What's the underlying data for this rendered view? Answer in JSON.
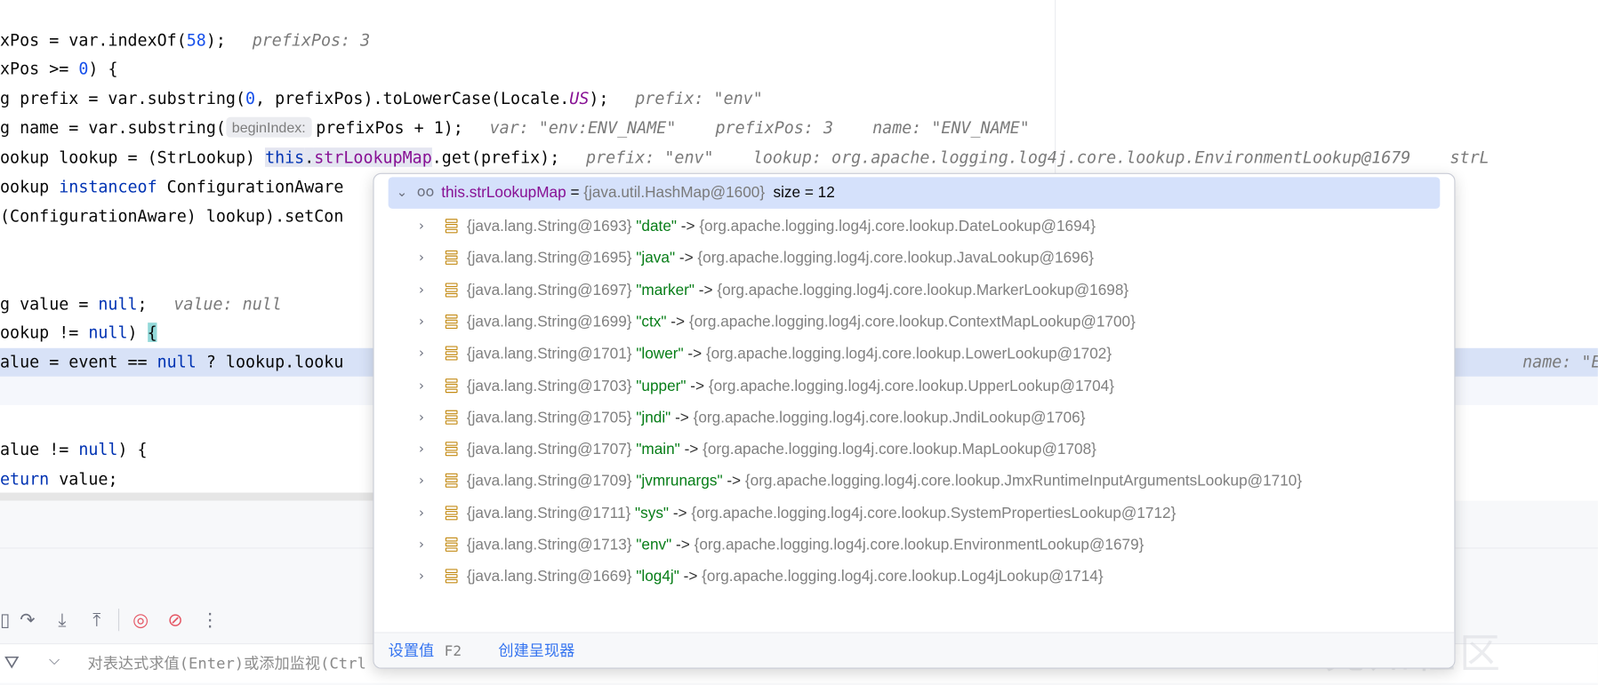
{
  "editor": {
    "lines": [
      {
        "text": "xPos = var.indexOf(58);",
        "inline": "prefixPos: 3"
      },
      {
        "text": "xPos >= 0) {"
      },
      {
        "text": "g prefix = var.substring(0, prefixPos).toLowerCase(Locale.US);",
        "inline": "prefix: \"env\""
      },
      {
        "pre": "g name = var.substring(",
        "hint": "beginIndex:",
        "post": "prefixPos + 1);",
        "inline": "var: \"env:ENV_NAME\"    prefixPos: 3    name: \"ENV_NAME\""
      },
      {
        "text": "ookup lookup = (StrLookup) this.strLookupMap.get(prefix);",
        "inline": "prefix: \"env\"    lookup: org.apache.logging.log4j.core.lookup.EnvironmentLookup@1679    strL"
      },
      {
        "text": "ookup instanceof ConfigurationAware"
      },
      {
        "text": "(ConfigurationAware) lookup).setCon"
      },
      {
        "text": "g value = null;",
        "inline": "value: null"
      },
      {
        "text": "ookup != null) {"
      },
      {
        "text": "alue = event == null ? lookup.looku",
        "inline": "name: \"ENV"
      },
      {
        "text": "alue != null) {"
      },
      {
        "text": "eturn value;"
      }
    ]
  },
  "popup": {
    "root": {
      "name": "this.strLookupMap",
      "eq": "=",
      "type": "{java.util.HashMap@1600}",
      "size": "size = 12"
    },
    "entries": [
      {
        "ref": "{java.lang.String@1693}",
        "key": "\"date\"",
        "arrow": "->",
        "val": "{org.apache.logging.log4j.core.lookup.DateLookup@1694}"
      },
      {
        "ref": "{java.lang.String@1695}",
        "key": "\"java\"",
        "arrow": "->",
        "val": "{org.apache.logging.log4j.core.lookup.JavaLookup@1696}"
      },
      {
        "ref": "{java.lang.String@1697}",
        "key": "\"marker\"",
        "arrow": "->",
        "val": "{org.apache.logging.log4j.core.lookup.MarkerLookup@1698}"
      },
      {
        "ref": "{java.lang.String@1699}",
        "key": "\"ctx\"",
        "arrow": "->",
        "val": "{org.apache.logging.log4j.core.lookup.ContextMapLookup@1700}"
      },
      {
        "ref": "{java.lang.String@1701}",
        "key": "\"lower\"",
        "arrow": "->",
        "val": "{org.apache.logging.log4j.core.lookup.LowerLookup@1702}"
      },
      {
        "ref": "{java.lang.String@1703}",
        "key": "\"upper\"",
        "arrow": "->",
        "val": "{org.apache.logging.log4j.core.lookup.UpperLookup@1704}"
      },
      {
        "ref": "{java.lang.String@1705}",
        "key": "\"jndi\"",
        "arrow": "->",
        "val": "{org.apache.logging.log4j.core.lookup.JndiLookup@1706}"
      },
      {
        "ref": "{java.lang.String@1707}",
        "key": "\"main\"",
        "arrow": "->",
        "val": "{org.apache.logging.log4j.core.lookup.MapLookup@1708}"
      },
      {
        "ref": "{java.lang.String@1709}",
        "key": "\"jvmrunargs\"",
        "arrow": "->",
        "val": "{org.apache.logging.log4j.core.lookup.JmxRuntimeInputArgumentsLookup@1710}"
      },
      {
        "ref": "{java.lang.String@1711}",
        "key": "\"sys\"",
        "arrow": "->",
        "val": "{org.apache.logging.log4j.core.lookup.SystemPropertiesLookup@1712}"
      },
      {
        "ref": "{java.lang.String@1713}",
        "key": "\"env\"",
        "arrow": "->",
        "val": "{org.apache.logging.log4j.core.lookup.EnvironmentLookup@1679}"
      },
      {
        "ref": "{java.lang.String@1669}",
        "key": "\"log4j\"",
        "arrow": "->",
        "val": "{org.apache.logging.log4j.core.lookup.Log4jLookup@1714}"
      }
    ],
    "footer": {
      "set_value": "设置值",
      "set_value_key": "F2",
      "create_renderer": "创建呈现器"
    }
  },
  "debugger": {
    "eval_placeholder": "对表达式求值(Enter)或添加监视(Ctrl",
    "watermark": "先知社区"
  },
  "colors": {
    "selection": "#d5e1fb",
    "keyword": "#0033b3",
    "string_key": "#067d17",
    "field": "#871094",
    "link": "#3574f0"
  }
}
